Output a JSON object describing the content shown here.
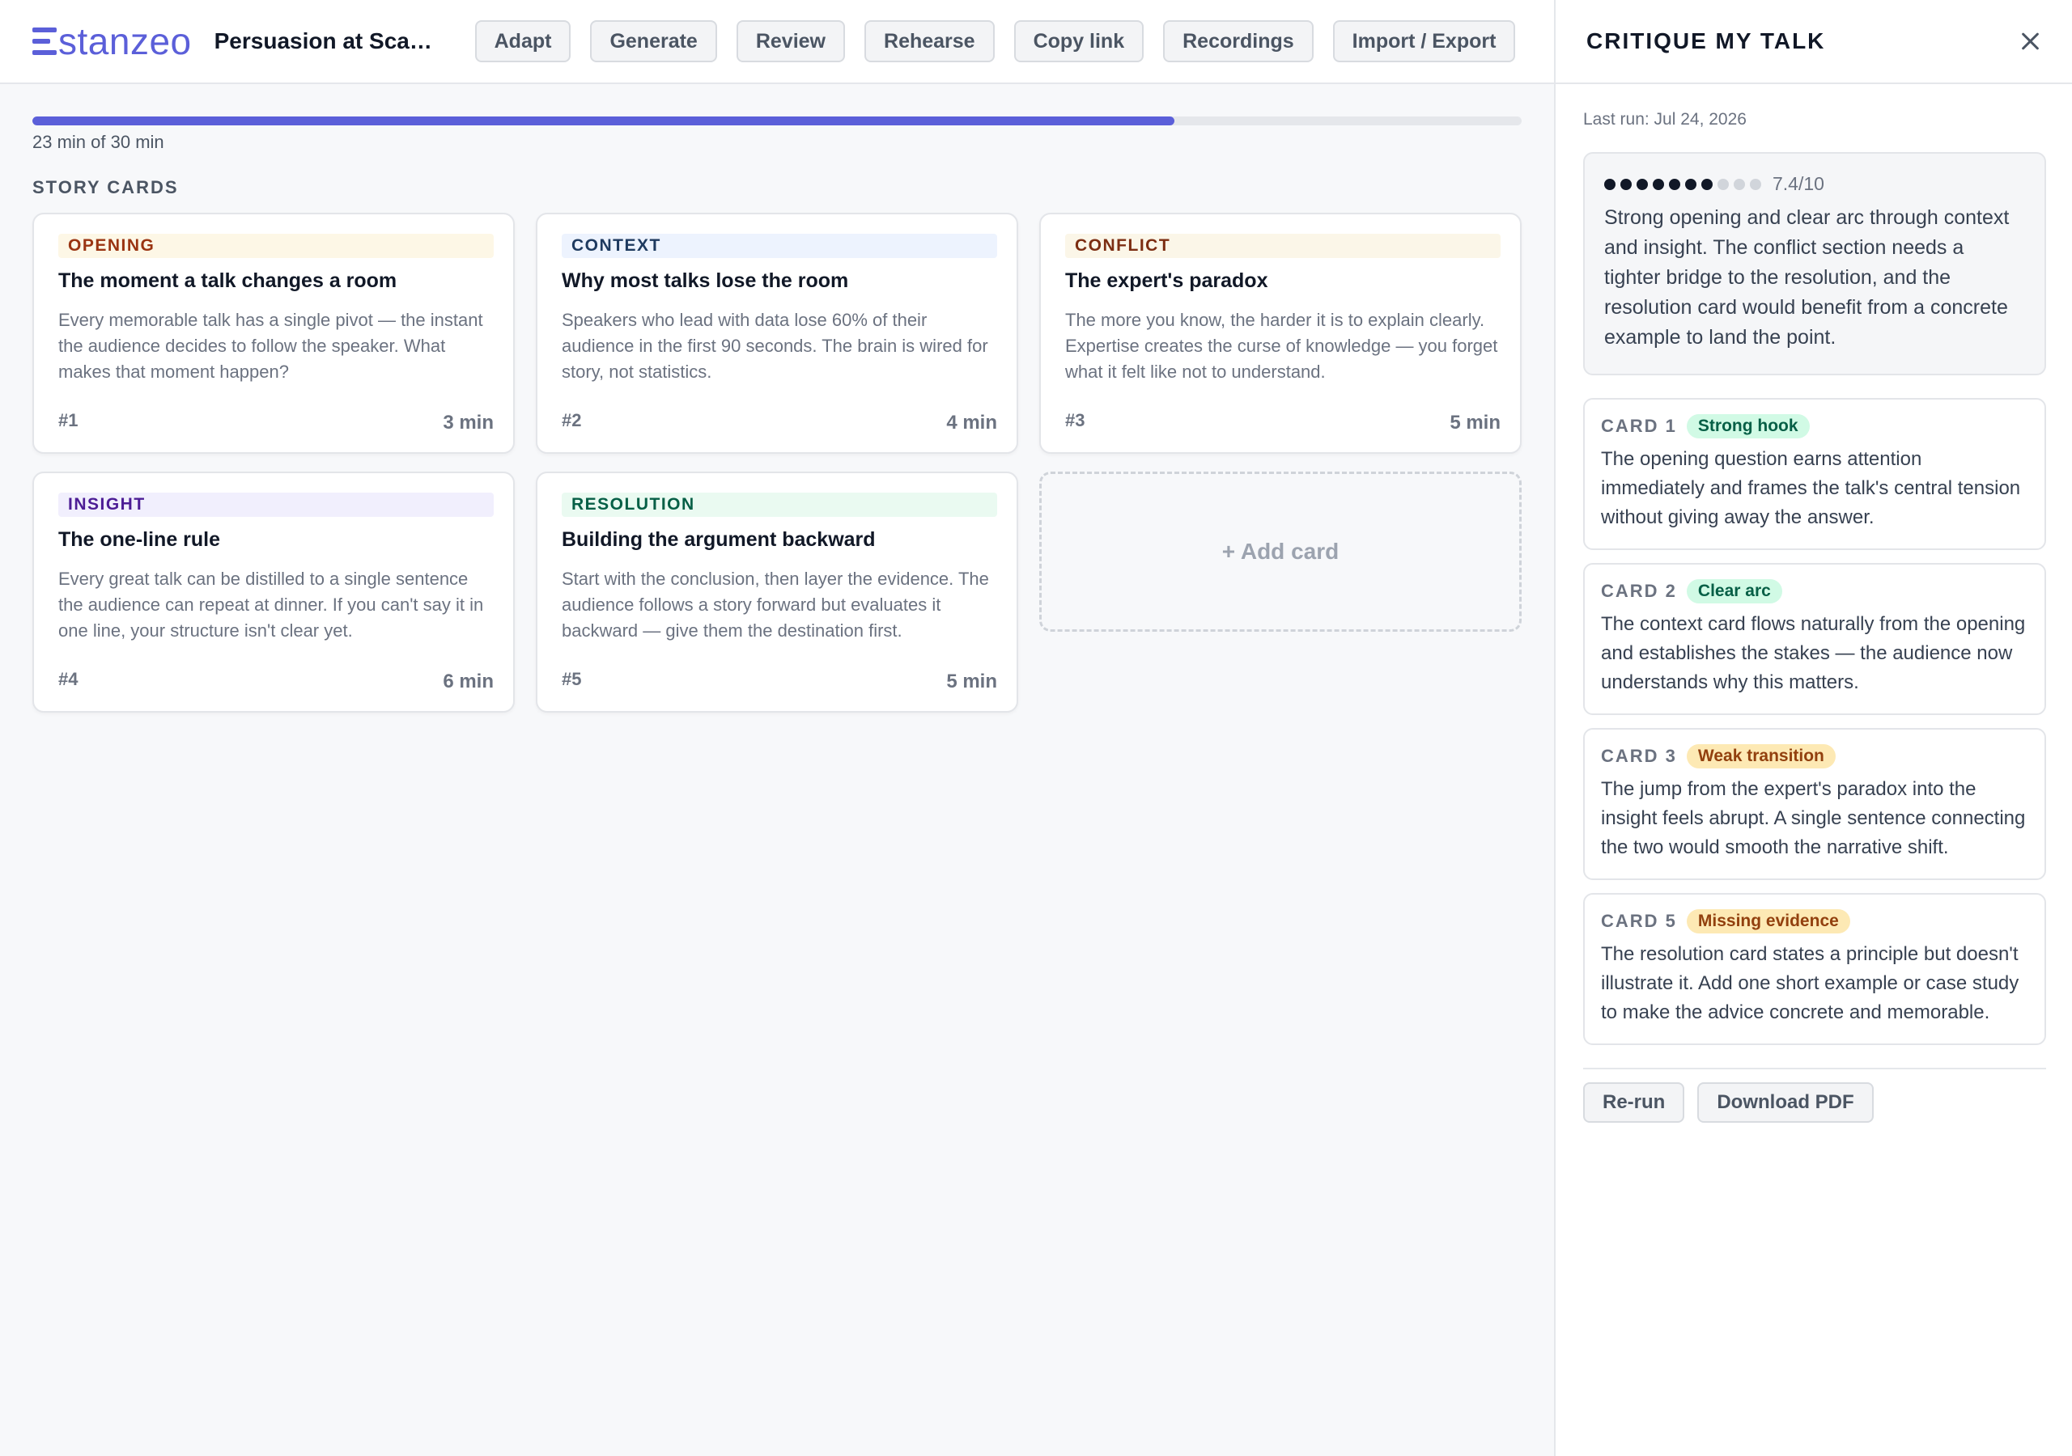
{
  "app": {
    "brand": "stanzeo",
    "doc_title": "Persuasion at Sca…",
    "accent": "#5b5fd9"
  },
  "nav": [
    {
      "label": "Adapt"
    },
    {
      "label": "Generate"
    },
    {
      "label": "Review"
    },
    {
      "label": "Rehearse"
    },
    {
      "label": "Copy link"
    },
    {
      "label": "Recordings"
    },
    {
      "label": "Import / Export"
    }
  ],
  "progress": {
    "label": "23 min of 30 min",
    "value": 23,
    "max": 30
  },
  "story": {
    "section_label": "STORY CARDS",
    "cards": [
      {
        "tag": "OPENING",
        "title": "The moment a talk changes a room",
        "body": "Every memorable talk has a single pivot — the instant the audience decides to follow the speaker. What makes that moment happen?",
        "num": "#1",
        "duration": "3 min"
      },
      {
        "tag": "CONTEXT",
        "title": "Why most talks lose the room",
        "body": "Speakers who lead with data lose 60% of their audience in the first 90 seconds. The brain is wired for story, not statistics.",
        "num": "#2",
        "duration": "4 min"
      },
      {
        "tag": "CONFLICT",
        "title": "The expert's paradox",
        "body": "The more you know, the harder it is to explain clearly. Expertise creates the curse of knowledge — you forget what it felt like not to understand.",
        "num": "#3",
        "duration": "5 min"
      },
      {
        "tag": "INSIGHT",
        "title": "The one-line rule",
        "body": "Every great talk can be distilled to a single sentence the audience can repeat at dinner. If you can't say it in one line, your structure isn't clear yet.",
        "num": "#4",
        "duration": "6 min"
      },
      {
        "tag": "RESOLUTION",
        "title": "Building the argument backward",
        "body": "Start with the conclusion, then layer the evidence. The audience follows a story forward but evaluates it backward — give them the destination first.",
        "num": "#5",
        "duration": "5 min"
      }
    ],
    "add_label": "+ Add card"
  },
  "panel": {
    "title": "CRITIQUE MY TALK",
    "last_run": "Last run: Jul 24, 2026",
    "score_text": "7.4/10",
    "score_dots": 7,
    "score_dots_total": 10,
    "summary": "Strong opening and clear arc through context and insight. The conflict section needs a tighter bridge to the resolution, and the resolution card would benefit from a concrete example to land the point.",
    "critiques": [
      {
        "label": "CARD 1",
        "badge": "Strong hook",
        "tone": "good",
        "text": "The opening question earns attention immediately and frames the talk's central tension without giving away the answer."
      },
      {
        "label": "CARD 2",
        "badge": "Clear arc",
        "tone": "good",
        "text": "The context card flows naturally from the opening and establishes the stakes — the audience now understands why this matters."
      },
      {
        "label": "CARD 3",
        "badge": "Weak transition",
        "tone": "warn",
        "text": "The jump from the expert's paradox into the insight feels abrupt. A single sentence connecting the two would smooth the narrative shift."
      },
      {
        "label": "CARD 5",
        "badge": "Missing evidence",
        "tone": "warn",
        "text": "The resolution card states a principle but doesn't illustrate it. Add one short example or case study to make the advice concrete and memorable."
      }
    ],
    "actions": [
      {
        "label": "Re-run"
      },
      {
        "label": "Download PDF"
      }
    ]
  }
}
